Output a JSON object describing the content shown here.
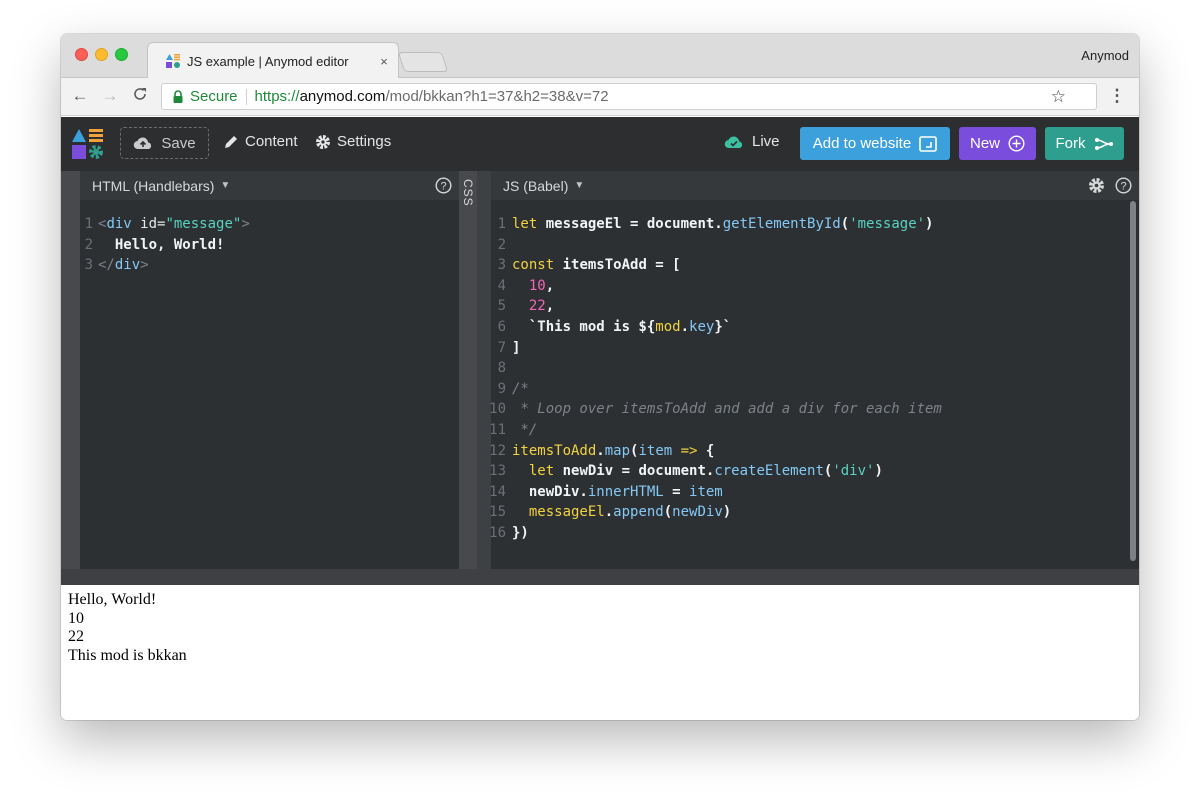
{
  "browser": {
    "tab_title": "JS example | Anymod editor",
    "tab_close": "×",
    "profile_name": "Anymod",
    "secure_label": "Secure",
    "url_scheme": "https://",
    "url_host": "anymod.com",
    "url_path": "/mod/bkkan?h1=37&h2=38&v=72",
    "back": "←",
    "forward": "→",
    "reload": "C",
    "star": "☆",
    "menu": "⋮"
  },
  "app": {
    "save_label": "Save",
    "content_label": "Content",
    "settings_label": "Settings",
    "live_label": "Live",
    "add_to_website_label": "Add to website",
    "new_label": "New",
    "fork_label": "Fork",
    "colors": {
      "add": "#3ca0dc",
      "new": "#7a4ddc",
      "fork": "#2e9f8e",
      "live": "#3cc0a0"
    }
  },
  "html_editor": {
    "title": "HTML (Handlebars)",
    "lines": [
      {
        "n": "1",
        "tokens": [
          [
            "punct",
            "<"
          ],
          [
            "tag",
            "div"
          ],
          [
            "attr",
            " id="
          ],
          [
            "str",
            "\"message\""
          ],
          [
            "punct",
            ">"
          ]
        ]
      },
      {
        "n": "2",
        "tokens": [
          [
            "wt",
            "  Hello, World!"
          ]
        ]
      },
      {
        "n": "3",
        "tokens": [
          [
            "punct",
            "</"
          ],
          [
            "tag",
            "div"
          ],
          [
            "punct",
            ">"
          ]
        ]
      }
    ]
  },
  "css_tab_label": "CSS",
  "js_editor": {
    "title": "JS (Babel)",
    "lines": [
      {
        "n": "1",
        "tokens": [
          [
            "kw",
            "let"
          ],
          [
            "wt",
            " messageEl = document."
          ],
          [
            "fn",
            "getElementById"
          ],
          [
            "wt",
            "("
          ],
          [
            "str",
            "'message'"
          ],
          [
            "wt",
            ")"
          ]
        ]
      },
      {
        "n": "2",
        "tokens": []
      },
      {
        "n": "3",
        "tokens": [
          [
            "kw",
            "const"
          ],
          [
            "wt",
            " itemsToAdd = ["
          ]
        ]
      },
      {
        "n": "4",
        "tokens": [
          [
            "wt",
            "  "
          ],
          [
            "num",
            "10"
          ],
          [
            "wt",
            ","
          ]
        ]
      },
      {
        "n": "5",
        "tokens": [
          [
            "wt",
            "  "
          ],
          [
            "num",
            "22"
          ],
          [
            "wt",
            ","
          ]
        ]
      },
      {
        "n": "6",
        "tokens": [
          [
            "wt",
            "  `This mod is ${"
          ],
          [
            "kw",
            "mod"
          ],
          [
            "wt",
            "."
          ],
          [
            "fn",
            "key"
          ],
          [
            "wt",
            "}`"
          ]
        ]
      },
      {
        "n": "7",
        "tokens": [
          [
            "wt",
            "]"
          ]
        ]
      },
      {
        "n": "8",
        "tokens": []
      },
      {
        "n": "9",
        "tokens": [
          [
            "com",
            "/*"
          ]
        ]
      },
      {
        "n": "10",
        "tokens": [
          [
            "com",
            " * Loop over itemsToAdd and add a div for each item"
          ]
        ]
      },
      {
        "n": "11",
        "tokens": [
          [
            "com",
            " */"
          ]
        ]
      },
      {
        "n": "12",
        "tokens": [
          [
            "kw",
            "itemsToAdd"
          ],
          [
            "wt",
            "."
          ],
          [
            "fn",
            "map"
          ],
          [
            "wt",
            "("
          ],
          [
            "fn",
            "item"
          ],
          [
            "kw",
            " =>"
          ],
          [
            "wt",
            " {"
          ]
        ]
      },
      {
        "n": "13",
        "tokens": [
          [
            "wt",
            "  "
          ],
          [
            "kw",
            "let"
          ],
          [
            "wt",
            " newDiv = document."
          ],
          [
            "fn",
            "createElement"
          ],
          [
            "wt",
            "("
          ],
          [
            "str",
            "'div'"
          ],
          [
            "wt",
            ")"
          ]
        ]
      },
      {
        "n": "14",
        "tokens": [
          [
            "wt",
            "  newDiv."
          ],
          [
            "fn",
            "innerHTML"
          ],
          [
            "wt",
            " = "
          ],
          [
            "fn",
            "item"
          ]
        ]
      },
      {
        "n": "15",
        "tokens": [
          [
            "wt",
            "  "
          ],
          [
            "kw",
            "messageEl"
          ],
          [
            "wt",
            "."
          ],
          [
            "fn",
            "append"
          ],
          [
            "wt",
            "("
          ],
          [
            "fn",
            "newDiv"
          ],
          [
            "wt",
            ")"
          ]
        ]
      },
      {
        "n": "16",
        "tokens": [
          [
            "wt",
            "})"
          ]
        ]
      }
    ]
  },
  "preview": {
    "lines": [
      "Hello, World!",
      "10",
      "22",
      "This mod is bkkan"
    ]
  }
}
